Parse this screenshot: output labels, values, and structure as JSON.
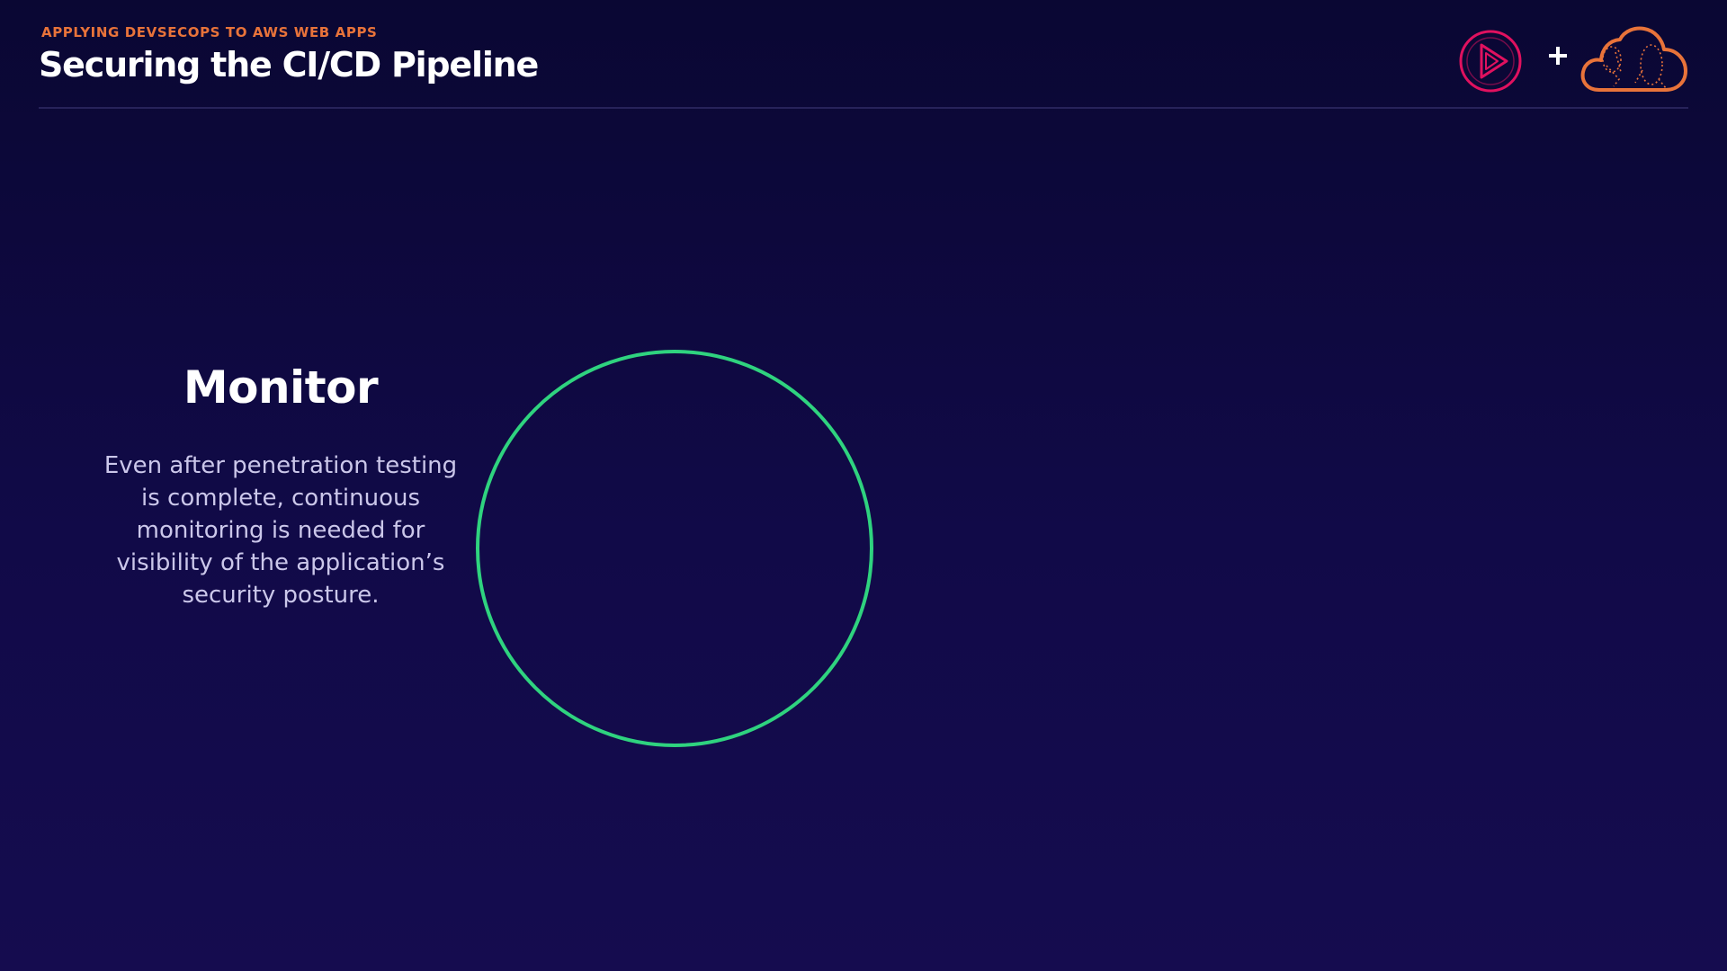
{
  "header": {
    "eyebrow": "APPLYING DEVSECOPS TO AWS WEB APPS",
    "title": "Securing the CI/CD Pipeline"
  },
  "brand": {
    "icons": [
      "pluralsight-play-logo",
      "plus-icon",
      "aws-cloud-icon"
    ],
    "colors": {
      "play": "#e0115f",
      "cloud": "#e8733a"
    }
  },
  "content": {
    "section_title": "Monitor",
    "description": "Even after penetration testing is complete, continuous monitoring is needed for visibility of the application’s security posture."
  },
  "colors": {
    "background": "#0f0a40",
    "accent_circle": "#2fd37f",
    "eyebrow": "#e8733a"
  }
}
